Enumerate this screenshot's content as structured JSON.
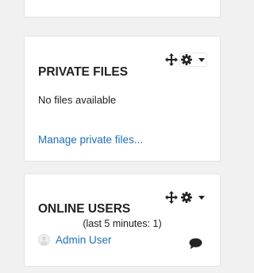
{
  "private_files": {
    "title": "PRIVATE FILES",
    "empty_text": "No files available",
    "manage_link": "Manage private files..."
  },
  "online_users": {
    "title": "ONLINE USERS",
    "summary": "(last 5 minutes: 1)",
    "users": [
      {
        "name": "Admin User"
      }
    ]
  },
  "icons": {
    "move": "move-icon",
    "settings": "gear-icon",
    "menu": "caret-down-icon",
    "message": "message-icon",
    "avatar": "avatar-placeholder-icon"
  },
  "colors": {
    "link": "#1f6fb5",
    "heading": "#222222",
    "background": "#f1f1f1",
    "panel": "#ffffff"
  }
}
